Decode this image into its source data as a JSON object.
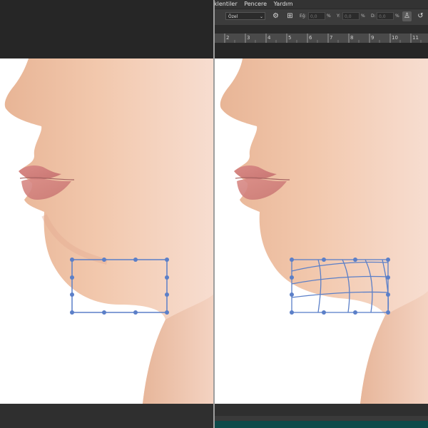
{
  "menu": {
    "items": [
      "klentiler",
      "Pencere",
      "Yardım"
    ]
  },
  "options_bar": {
    "preset_value": "Özel",
    "caret": "⌄",
    "fields": [
      {
        "label": "Eğ:",
        "value": "0,0",
        "unit": "%"
      },
      {
        "label": "Y:",
        "value": "0,0",
        "unit": "%"
      },
      {
        "label": "D:",
        "value": "0,0",
        "unit": "%"
      }
    ],
    "icons": [
      "gear-icon",
      "grid-icon",
      "puppet-warp-icon",
      "reset-icon"
    ]
  },
  "ruler": {
    "labels": [
      "2",
      "3",
      "4",
      "5",
      "6",
      "7",
      "8",
      "9",
      "10",
      "11"
    ]
  },
  "colors": {
    "ui_dark": "#262626",
    "ui_panel": "#3c3c3c",
    "warp_handle": "#5b7fc8",
    "accent_teal": "#0e4a4a"
  }
}
